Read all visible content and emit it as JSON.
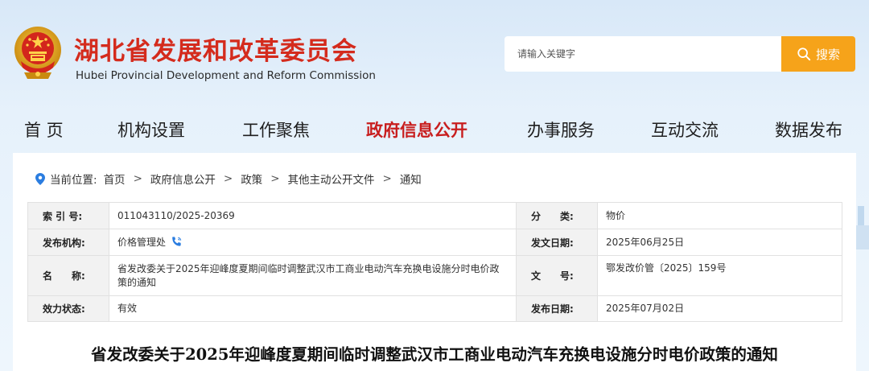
{
  "header": {
    "title_cn": "湖北省发展和改革委员会",
    "title_en": "Hubei Provincial Development and Reform Commission"
  },
  "search": {
    "placeholder": "请输入关键字",
    "button_label": "搜索"
  },
  "nav": {
    "items": [
      {
        "label": "首 页",
        "active": false
      },
      {
        "label": "机构设置",
        "active": false
      },
      {
        "label": "工作聚焦",
        "active": false
      },
      {
        "label": "政府信息公开",
        "active": true
      },
      {
        "label": "办事服务",
        "active": false
      },
      {
        "label": "互动交流",
        "active": false
      },
      {
        "label": "数据发布",
        "active": false
      }
    ]
  },
  "breadcrumb": {
    "prefix": "当前位置:",
    "items": [
      "首页",
      "政府信息公开",
      "政策",
      "其他主动公开文件",
      "通知"
    ]
  },
  "info": {
    "rows": [
      {
        "l1": "索 引 号:",
        "v1": "011043110/2025-20369",
        "l2": "分　　类:",
        "v2": "物价"
      },
      {
        "l1": "发布机构:",
        "v1": "价格管理处",
        "l2": "发文日期:",
        "v2": "2025年06月25日"
      },
      {
        "l1": "名　　称:",
        "v1": "省发改委关于2025年迎峰度夏期间临时调整武汉市工商业电动汽车充换电设施分时电价政策的通知",
        "l2": "文　　号:",
        "v2": "鄂发改价管〔2025〕159号"
      },
      {
        "l1": "效力状态:",
        "v1": "有效",
        "l2": "发布日期:",
        "v2": "2025年07月02日"
      }
    ]
  },
  "document": {
    "title": "省发改委关于2025年迎峰度夏期间临时调整武汉市工商业电动汽车充换电设施分时电价政策的通知"
  },
  "colors": {
    "brand_red": "#d42b1d",
    "accent_orange": "#f6a31a",
    "nav_active": "#c81e1e"
  }
}
